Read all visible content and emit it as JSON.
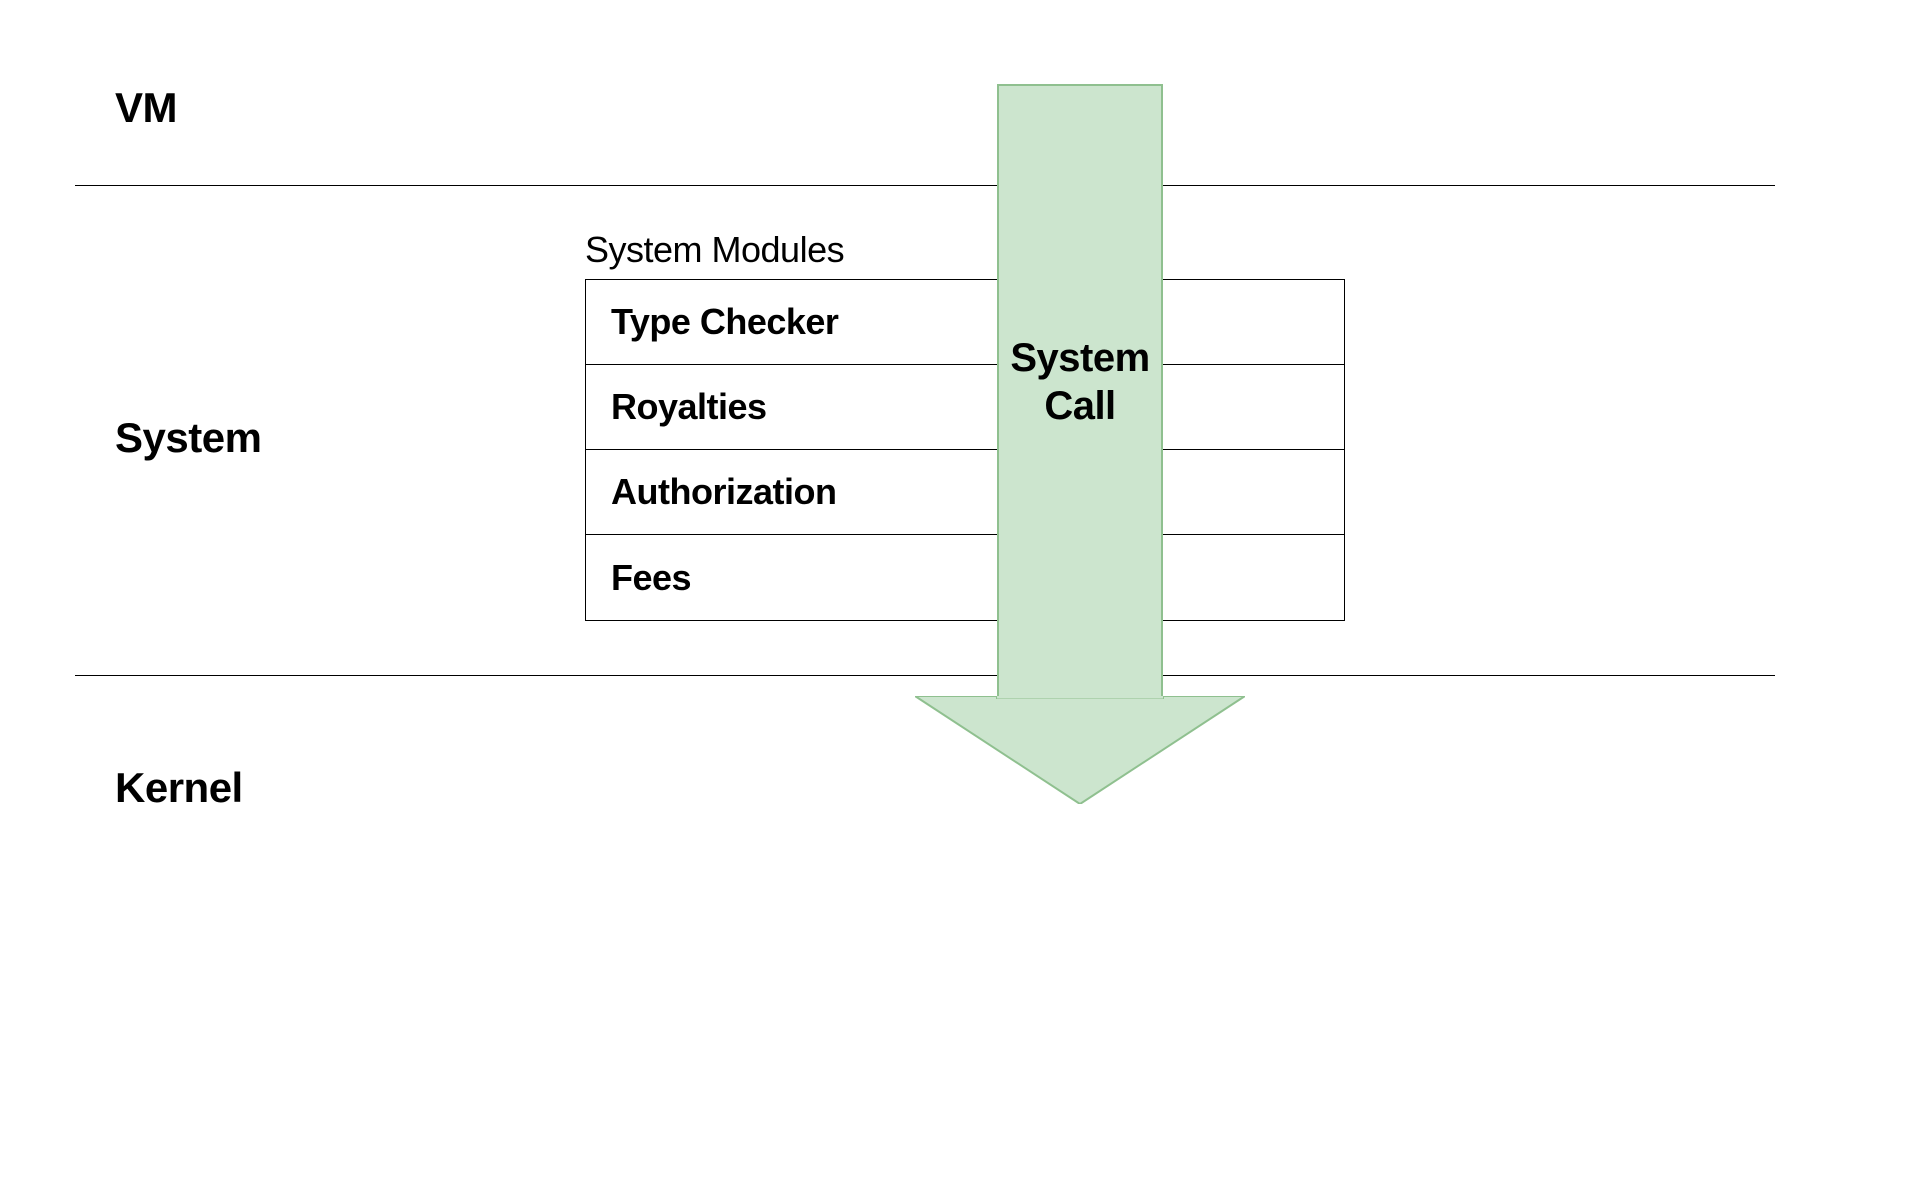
{
  "layers": {
    "vm": "VM",
    "system": "System",
    "kernel": "Kernel"
  },
  "modules": {
    "heading": "System Modules",
    "items": [
      "Type Checker",
      "Royalties",
      "Authorization",
      "Fees"
    ]
  },
  "arrow": {
    "label_line1": "System",
    "label_line2": "Call",
    "fill_color": "#cce5ce",
    "stroke_color": "#8fc08f"
  }
}
